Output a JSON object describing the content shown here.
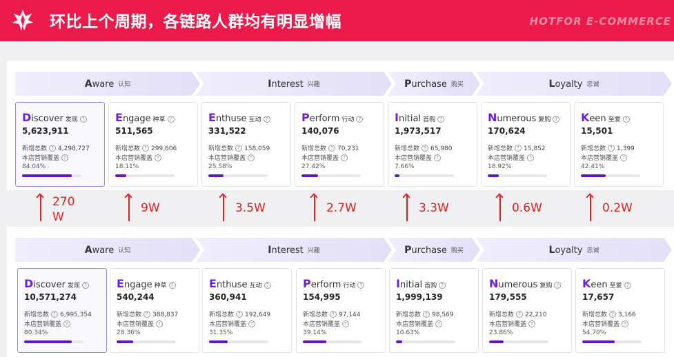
{
  "header": {
    "title": "环比上个周期，各链路人群均有明显增幅",
    "brand": "HOTFOR E-COMMERCE"
  },
  "stages": [
    {
      "initial": "A",
      "rest": "ware",
      "cn": "认知"
    },
    {
      "initial": "I",
      "rest": "nterest",
      "cn": "兴趣"
    },
    {
      "initial": "P",
      "rest": "urchase",
      "cn": "购买"
    },
    {
      "initial": "L",
      "rest": "oyalty",
      "cn": "忠诚"
    }
  ],
  "labels": {
    "new_total": "新增总数",
    "coverage": "本店营销覆盖",
    "help": "?"
  },
  "before": [
    {
      "initial": "D",
      "rest": "iscover",
      "cn": "发现",
      "value": "5,623,911",
      "new_total": "4,298,727",
      "coverage": "84.04%",
      "coverage_pct": 84.04
    },
    {
      "initial": "E",
      "rest": "ngage",
      "cn": "种草",
      "value": "511,565",
      "new_total": "299,606",
      "coverage": "18.11%",
      "coverage_pct": 18.11
    },
    {
      "initial": "E",
      "rest": "nthuse",
      "cn": "互动",
      "value": "331,522",
      "new_total": "158,059",
      "coverage": "25.58%",
      "coverage_pct": 25.58
    },
    {
      "initial": "P",
      "rest": "erform",
      "cn": "行动",
      "value": "140,076",
      "new_total": "70,231",
      "coverage": "27.42%",
      "coverage_pct": 27.42
    },
    {
      "initial": "I",
      "rest": "nitial",
      "cn": "首购",
      "value": "1,973,517",
      "new_total": "65,980",
      "coverage": "7.66%",
      "coverage_pct": 7.66
    },
    {
      "initial": "N",
      "rest": "umerous",
      "cn": "复购",
      "value": "170,624",
      "new_total": "15,852",
      "coverage": "18.92%",
      "coverage_pct": 18.92
    },
    {
      "initial": "K",
      "rest": "een",
      "cn": "至爱",
      "value": "15,501",
      "new_total": "1,399",
      "coverage": "42.41%",
      "coverage_pct": 42.41
    }
  ],
  "increases": [
    "270\nW",
    "9W",
    "3.5W",
    "2.7W",
    "3.3W",
    "0.6W",
    "0.2W"
  ],
  "after": [
    {
      "initial": "D",
      "rest": "iscover",
      "cn": "发现",
      "value": "10,571,274",
      "new_total": "6,995,354",
      "coverage": "80.34%",
      "coverage_pct": 80.34
    },
    {
      "initial": "E",
      "rest": "ngage",
      "cn": "种草",
      "value": "540,244",
      "new_total": "388,837",
      "coverage": "28.36%",
      "coverage_pct": 28.36
    },
    {
      "initial": "E",
      "rest": "nthuse",
      "cn": "互动",
      "value": "360,941",
      "new_total": "192,649",
      "coverage": "31.35%",
      "coverage_pct": 31.35
    },
    {
      "initial": "P",
      "rest": "erform",
      "cn": "行动",
      "value": "154,995",
      "new_total": "97,144",
      "coverage": "39.14%",
      "coverage_pct": 39.14
    },
    {
      "initial": "I",
      "rest": "nitial",
      "cn": "首购",
      "value": "1,999,139",
      "new_total": "98,569",
      "coverage": "10.63%",
      "coverage_pct": 10.63
    },
    {
      "initial": "N",
      "rest": "umerous",
      "cn": "复购",
      "value": "179,555",
      "new_total": "22,210",
      "coverage": "23.86%",
      "coverage_pct": 23.86
    },
    {
      "initial": "K",
      "rest": "een",
      "cn": "至爱",
      "value": "17,657",
      "new_total": "3,166",
      "coverage": "54.70%",
      "coverage_pct": 54.7
    }
  ],
  "colors": {
    "header_bg": "#ec1a4b",
    "accent": "#5b17c9",
    "increase": "#e0201f"
  }
}
